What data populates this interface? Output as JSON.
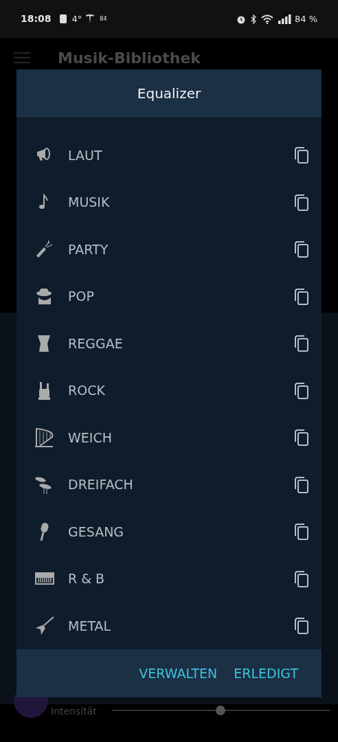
{
  "status_bar": {
    "time": "18:08",
    "temperature": "4°",
    "badge": "84",
    "battery": "84 %"
  },
  "app_bar": {
    "title": "Musik-Bibliothek"
  },
  "background": {
    "slider_label": "Intensität",
    "level": 0.5
  },
  "dialog": {
    "title": "Equalizer",
    "presets": [
      {
        "label": "LAUT",
        "kind": "megaphone"
      },
      {
        "label": "MUSIK",
        "kind": "note"
      },
      {
        "label": "PARTY",
        "kind": "bottle"
      },
      {
        "label": "POP",
        "kind": "hat"
      },
      {
        "label": "REGGAE",
        "kind": "drum"
      },
      {
        "label": "ROCK",
        "kind": "hand"
      },
      {
        "label": "WEICH",
        "kind": "harp"
      },
      {
        "label": "DREIFACH",
        "kind": "cymbal"
      },
      {
        "label": "GESANG",
        "kind": "mic"
      },
      {
        "label": "R & B",
        "kind": "keyboard"
      },
      {
        "label": "METAL",
        "kind": "guitar"
      }
    ],
    "buttons": [
      "VERWALTEN",
      "ERLEDIGT"
    ]
  }
}
